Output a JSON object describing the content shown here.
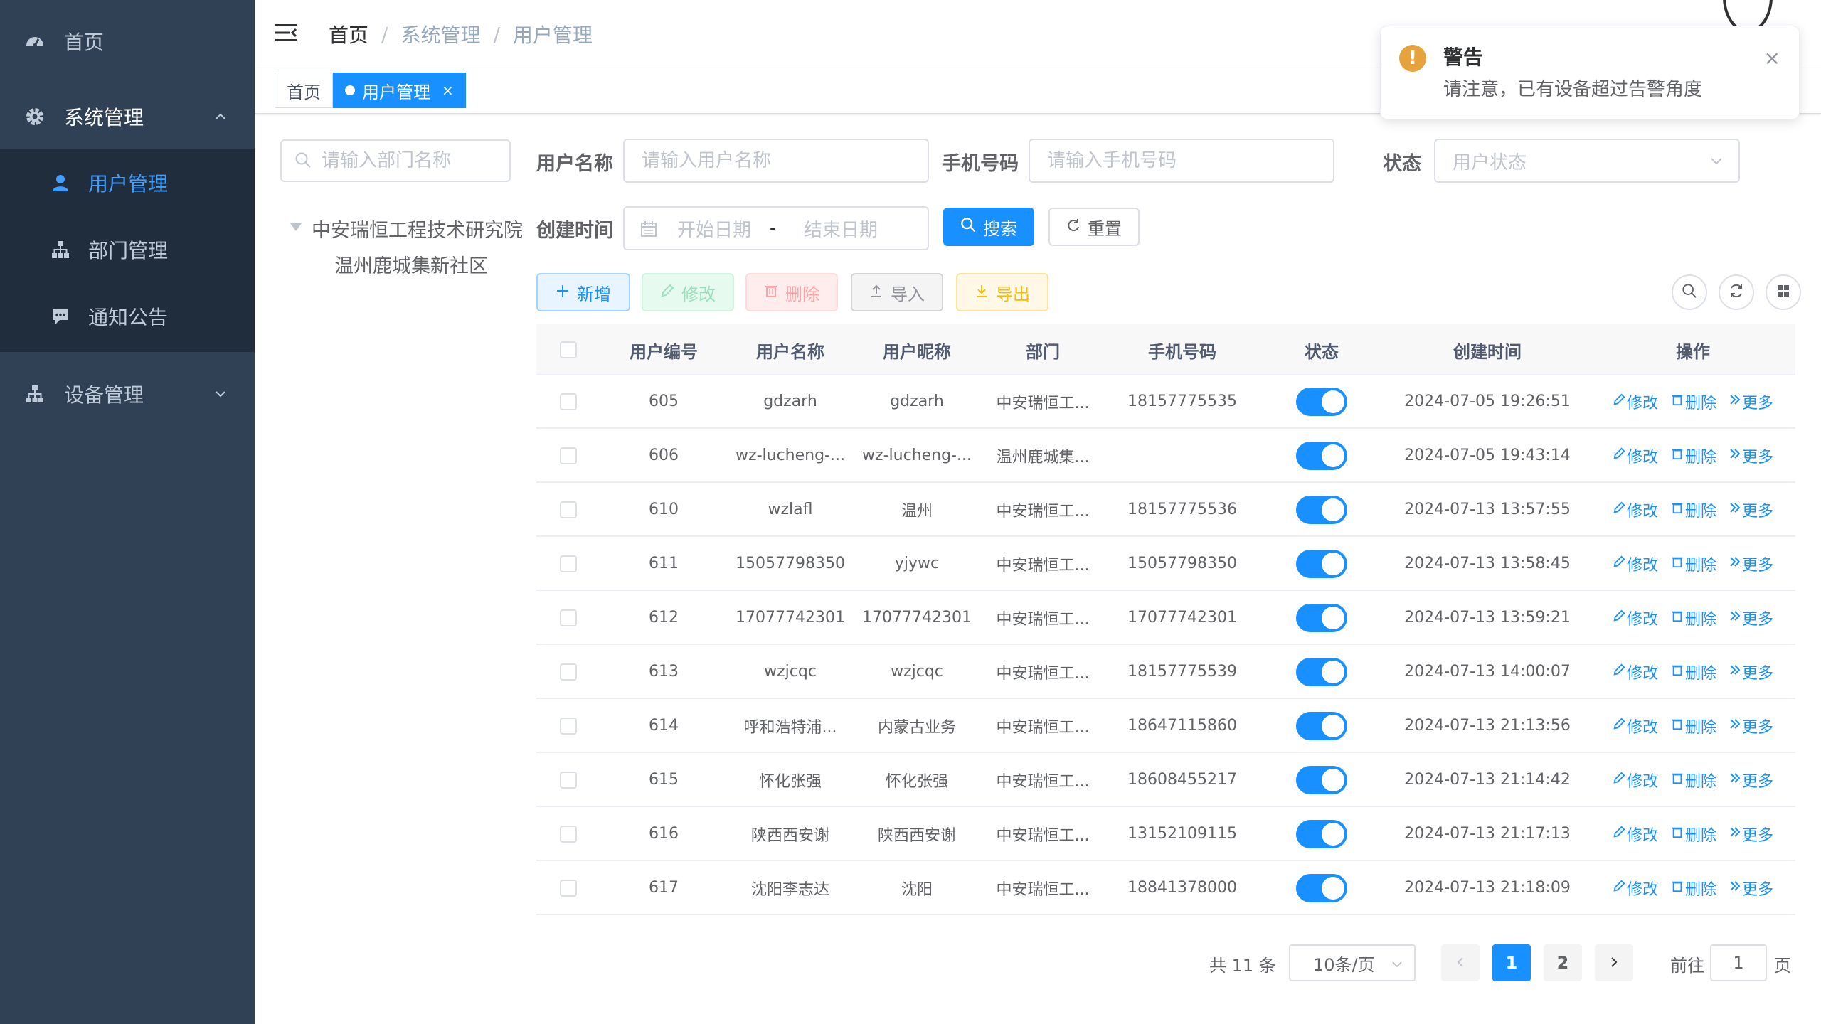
{
  "sidebar": {
    "home": "首页",
    "system": "系统管理",
    "system_children": [
      "用户管理",
      "部门管理",
      "通知公告"
    ],
    "device": "设备管理"
  },
  "navbar": {
    "breadcrumb": [
      "首页",
      "系统管理",
      "用户管理"
    ],
    "separator": "/"
  },
  "tags": {
    "home": "首页",
    "active": "用户管理",
    "close": "×"
  },
  "tree": {
    "search_placeholder": "请输入部门名称",
    "nodes": [
      "中安瑞恒工程技术研究院",
      "温州鹿城集新社区"
    ]
  },
  "form": {
    "username_label": "用户名称",
    "username_placeholder": "请输入用户名称",
    "phone_label": "手机号码",
    "phone_placeholder": "请输入手机号码",
    "status_label": "状态",
    "status_placeholder": "用户状态",
    "created_label": "创建时间",
    "start_placeholder": "开始日期",
    "range_sep": "-",
    "end_placeholder": "结束日期",
    "search": "搜索",
    "reset": "重置"
  },
  "toolbar": {
    "add": "新增",
    "edit": "修改",
    "delete": "删除",
    "import": "导入",
    "export": "导出"
  },
  "table": {
    "columns": [
      "用户编号",
      "用户名称",
      "用户昵称",
      "部门",
      "手机号码",
      "状态",
      "创建时间",
      "操作"
    ],
    "rows": [
      {
        "id": "605",
        "name": "gdzarh",
        "nick": "gdzarh",
        "dept": "中安瑞恒工...",
        "phone": "18157775535",
        "status": true,
        "created": "2024-07-05 19:26:51"
      },
      {
        "id": "606",
        "name": "wz-lucheng-...",
        "nick": "wz-lucheng-...",
        "dept": "温州鹿城集...",
        "phone": "",
        "status": true,
        "created": "2024-07-05 19:43:14"
      },
      {
        "id": "610",
        "name": "wzlafl",
        "nick": "温州",
        "dept": "中安瑞恒工...",
        "phone": "18157775536",
        "status": true,
        "created": "2024-07-13 13:57:55"
      },
      {
        "id": "611",
        "name": "15057798350",
        "nick": "yjywc",
        "dept": "中安瑞恒工...",
        "phone": "15057798350",
        "status": true,
        "created": "2024-07-13 13:58:45"
      },
      {
        "id": "612",
        "name": "17077742301",
        "nick": "17077742301",
        "dept": "中安瑞恒工...",
        "phone": "17077742301",
        "status": true,
        "created": "2024-07-13 13:59:21"
      },
      {
        "id": "613",
        "name": "wzjcqc",
        "nick": "wzjcqc",
        "dept": "中安瑞恒工...",
        "phone": "18157775539",
        "status": true,
        "created": "2024-07-13 14:00:07"
      },
      {
        "id": "614",
        "name": "呼和浩特浦...",
        "nick": "内蒙古业务",
        "dept": "中安瑞恒工...",
        "phone": "18647115860",
        "status": true,
        "created": "2024-07-13 21:13:56"
      },
      {
        "id": "615",
        "name": "怀化张强",
        "nick": "怀化张强",
        "dept": "中安瑞恒工...",
        "phone": "18608455217",
        "status": true,
        "created": "2024-07-13 21:14:42"
      },
      {
        "id": "616",
        "name": "陕西西安谢",
        "nick": "陕西西安谢",
        "dept": "中安瑞恒工...",
        "phone": "13152109115",
        "status": true,
        "created": "2024-07-13 21:17:13"
      },
      {
        "id": "617",
        "name": "沈阳李志达",
        "nick": "沈阳",
        "dept": "中安瑞恒工...",
        "phone": "18841378000",
        "status": true,
        "created": "2024-07-13 21:18:09"
      }
    ],
    "op_edit": "修改",
    "op_delete": "删除",
    "op_more": "更多"
  },
  "pagination": {
    "total": "共 11 条",
    "page_size": "10条/页",
    "pages": [
      "1",
      "2"
    ],
    "current": "1",
    "goto_label": "前往",
    "goto_value": "1",
    "goto_unit": "页"
  },
  "notification": {
    "title": "警告",
    "message": "请注意，已有设备超过告警角度",
    "icon": "!",
    "close": "×"
  },
  "colors": {
    "primary": "#1890ff",
    "sidebar_bg": "#304156",
    "submenu_bg": "#1f2d3d",
    "warning": "#e6a23c"
  }
}
